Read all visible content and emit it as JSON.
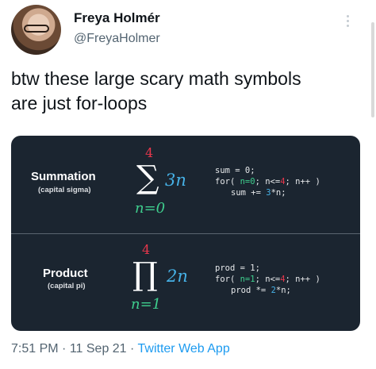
{
  "author": {
    "name": "Freya Holmér",
    "handle": "@FreyaHolmer"
  },
  "tweet": {
    "line1": "btw these large scary math symbols",
    "line2": "are just for-loops"
  },
  "card": {
    "summation": {
      "title": "Summation",
      "subtitle": "(capital sigma)",
      "upper": "4",
      "symbol": "∑",
      "coef": "3n",
      "lower": "n=0",
      "code": {
        "l1": "sum = 0;",
        "l2_a": "for( ",
        "l2_init": "n=0",
        "l2_b": "; n<=",
        "l2_limit": "4",
        "l2_c": "; n++ )",
        "l3_a": "sum += ",
        "l3_coef": "3",
        "l3_b": "*n;"
      }
    },
    "product": {
      "title": "Product",
      "subtitle": "(capital pi)",
      "upper": "4",
      "symbol": "∏",
      "coef": "2n",
      "lower": "n=1",
      "code": {
        "l1": "prod = 1;",
        "l2_a": "for( ",
        "l2_init": "n=1",
        "l2_b": "; n<=",
        "l2_limit": "4",
        "l2_c": "; n++ )",
        "l3_a": "prod *= ",
        "l3_coef": "2",
        "l3_b": "*n;"
      }
    }
  },
  "footer": {
    "time": "7:51 PM",
    "sep1": " · ",
    "date": "11 Sep 21",
    "sep2": " · ",
    "app": "Twitter Web App"
  },
  "colors": {
    "card_bg": "#1b2530",
    "upper": "#e8374c",
    "lower": "#3fcf8e",
    "coef": "#46b1e6",
    "link": "#1d9bf0"
  },
  "icons": {
    "more": "more-vertical-icon"
  }
}
